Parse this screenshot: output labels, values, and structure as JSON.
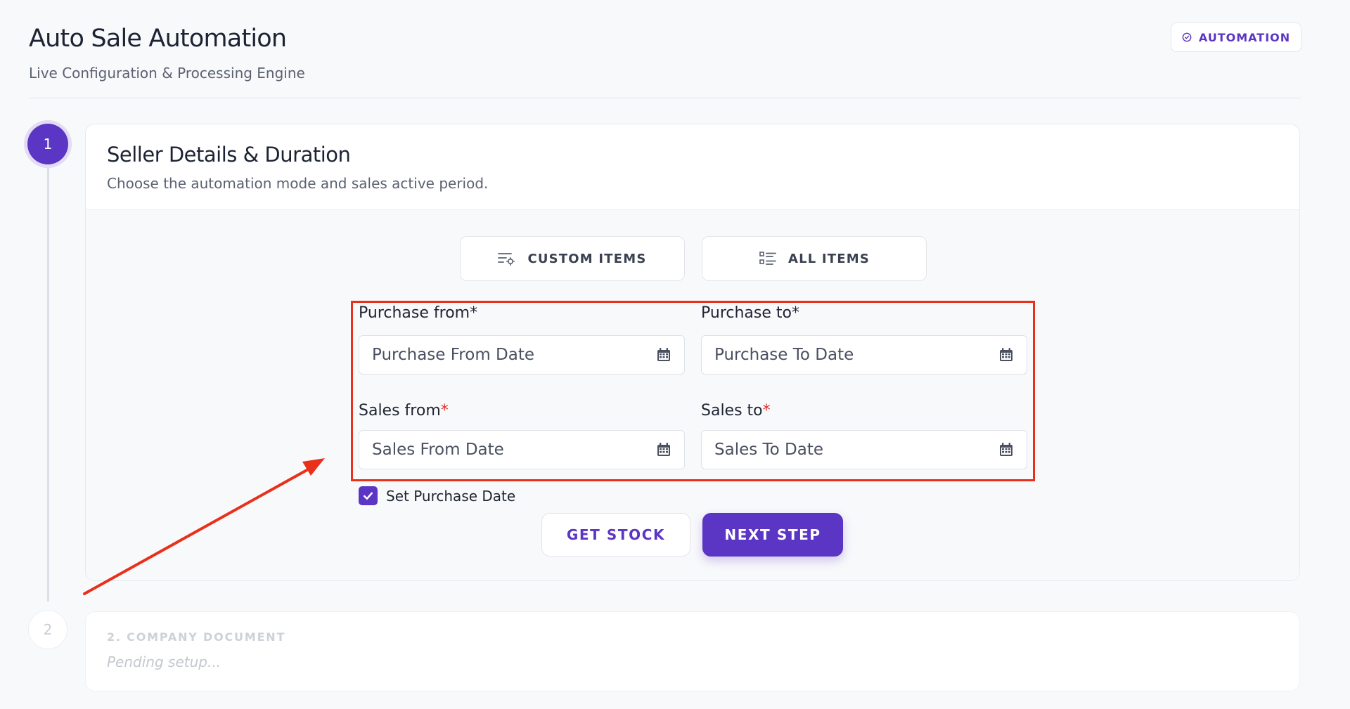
{
  "header": {
    "title": "Auto Sale Automation",
    "subtitle": "Live Configuration & Processing Engine",
    "badge": {
      "icon": "check-circle-icon",
      "label": "AUTOMATION"
    }
  },
  "steps": [
    {
      "number": "1",
      "title": "Seller Details & Duration",
      "description": "Choose the automation mode and sales active period.",
      "mode_buttons": [
        {
          "icon": "list-settings-icon",
          "label": "CUSTOM ITEMS"
        },
        {
          "icon": "list-icon",
          "label": "ALL ITEMS"
        }
      ],
      "fields": {
        "purchase_from": {
          "label": "Purchase from",
          "required_mark": "*",
          "placeholder": "Purchase From Date"
        },
        "purchase_to": {
          "label": "Purchase to",
          "required_mark": "*",
          "placeholder": "Purchase To Date"
        },
        "sales_from": {
          "label": "Sales from",
          "required_mark": "*",
          "placeholder": "Sales From Date"
        },
        "sales_to": {
          "label": "Sales to",
          "required_mark": "*",
          "placeholder": "Sales To Date"
        }
      },
      "checkbox": {
        "label": "Set Purchase Date",
        "checked": true
      },
      "buttons": {
        "secondary": "GET STOCK",
        "primary": "NEXT STEP"
      }
    },
    {
      "number": "2",
      "title": "2. COMPANY DOCUMENT",
      "status": "Pending setup..."
    }
  ],
  "colors": {
    "accent": "#5b35c4",
    "annotation": "#e8301a",
    "required": "#e02f2f"
  }
}
